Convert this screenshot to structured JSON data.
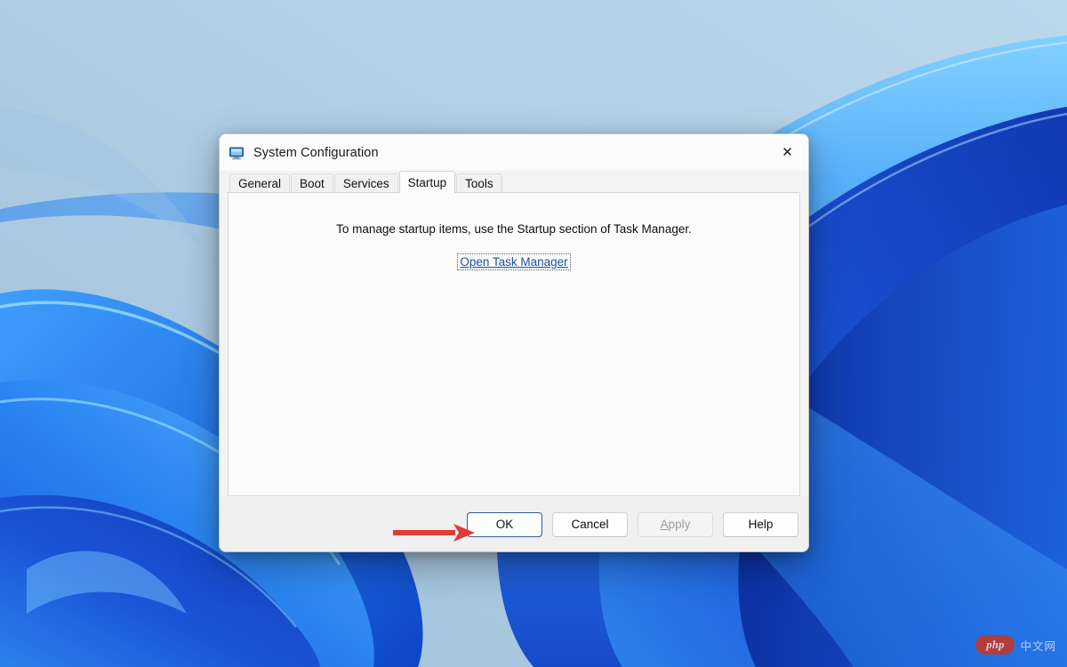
{
  "desktop": {
    "wallpaper_name": "windows-11-bloom-wallpaper",
    "colors": {
      "sky_light": "#b9d5e9",
      "sky_mid": "#a9c8e0",
      "ribbon_bright": "#2f8ff5",
      "ribbon_mid": "#1f6fe0",
      "ribbon_deep": "#0f3fbf",
      "ribbon_highlight": "#69c6ff",
      "ribbon_dark": "#0a2a9e"
    }
  },
  "dialog": {
    "title": "System Configuration",
    "title_icon": "system-configuration-monitor-icon",
    "close_icon": "✕",
    "tabs": [
      {
        "label": "General",
        "selected": false
      },
      {
        "label": "Boot",
        "selected": false
      },
      {
        "label": "Services",
        "selected": false
      },
      {
        "label": "Startup",
        "selected": true
      },
      {
        "label": "Tools",
        "selected": false
      }
    ],
    "content": {
      "info_text": "To manage startup items, use the Startup section of Task Manager.",
      "link_label": "Open Task Manager",
      "link_color": "#1b53a8",
      "link_focused": true
    },
    "buttons": [
      {
        "label": "OK",
        "state": "default-focused",
        "accel": ""
      },
      {
        "label": "Cancel",
        "state": "normal",
        "accel": ""
      },
      {
        "label": "Apply",
        "state": "disabled",
        "accel": "A"
      },
      {
        "label": "Help",
        "state": "normal",
        "accel": ""
      }
    ]
  },
  "annotation": {
    "arrow_color": "#e03c38",
    "arrow_points_to": "OK"
  },
  "watermark": {
    "badge_text": "php",
    "site_text": "中文网",
    "badge_color": "#c0392b"
  }
}
